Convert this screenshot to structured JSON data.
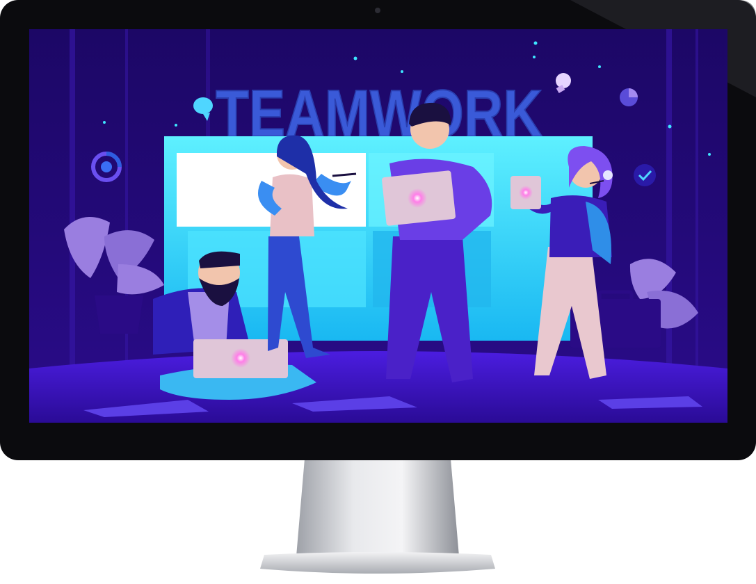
{
  "scene": {
    "headline": "TEAMWORK"
  },
  "colors": {
    "bezel": "#0b0b0e",
    "screen_bg": "#1f0a6e",
    "backdrop_cyan": "#2fe0ff",
    "headline": "#3a5ad8",
    "floor": "#3a15c9",
    "plant": "#9a7ee0",
    "stand_silver": "#c9cbd0"
  },
  "icons": [
    "camera-icon",
    "chat-bubble-icon",
    "pie-chart-icon",
    "donut-chart-icon",
    "checkmark-icon",
    "lightbulb-icon"
  ]
}
